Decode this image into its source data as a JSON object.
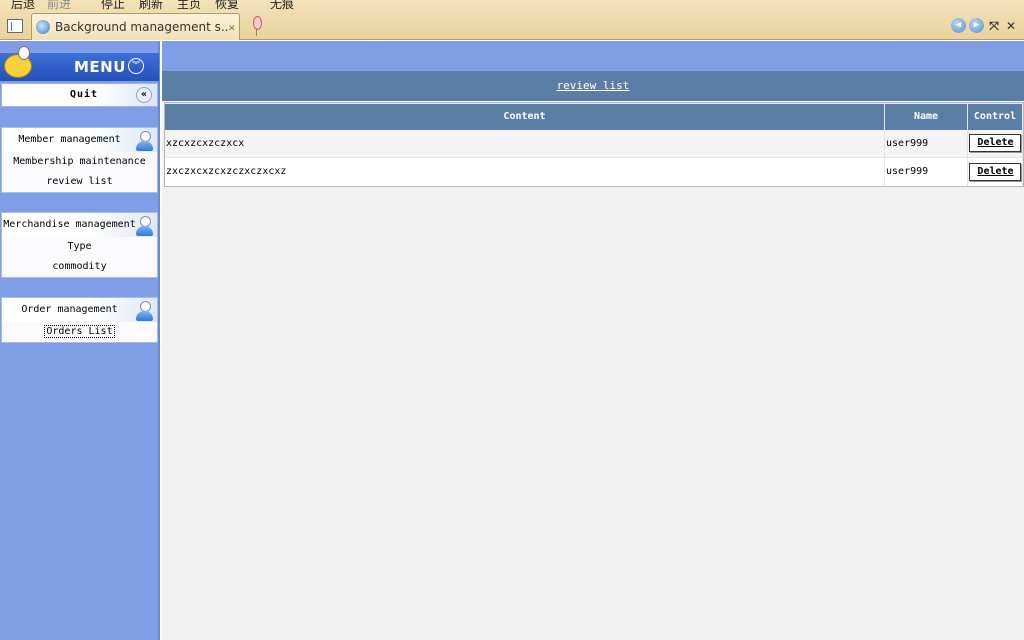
{
  "browser": {
    "toolbar": {
      "back": "后退",
      "forward": "前进",
      "stop": "停止",
      "refresh": "刷新",
      "home": "主页",
      "restore": "恢复",
      "no_trace": "无痕"
    },
    "tab_title": "Background management s...",
    "nav_icons": [
      "back-circle-icon",
      "forward-circle-icon",
      "fullscreen-icon",
      "close-icon"
    ]
  },
  "sidebar": {
    "menu_title": "MENU",
    "quit_label": "Quit",
    "groups": [
      {
        "title": "Member management",
        "items": [
          "Membership maintenance",
          "review list"
        ]
      },
      {
        "title": "Merchandise management",
        "items": [
          "Type",
          "commodity"
        ]
      },
      {
        "title": "Order management",
        "items": [
          "Orders List"
        ]
      }
    ]
  },
  "main": {
    "list_title": "review list",
    "columns": [
      "Content",
      "Name",
      "Control"
    ],
    "rows": [
      {
        "content": "xzcxzcxzczxcx",
        "name": "user999",
        "action": "Delete"
      },
      {
        "content": "zxczxcxzcxzczxczxcxz",
        "name": "user999",
        "action": "Delete"
      }
    ]
  },
  "colors": {
    "frame_blue": "#7f9ee6",
    "header_slate": "#5a7ea6",
    "menu_blue": "#2451b8",
    "chrome_tan": "#e9d29e"
  }
}
